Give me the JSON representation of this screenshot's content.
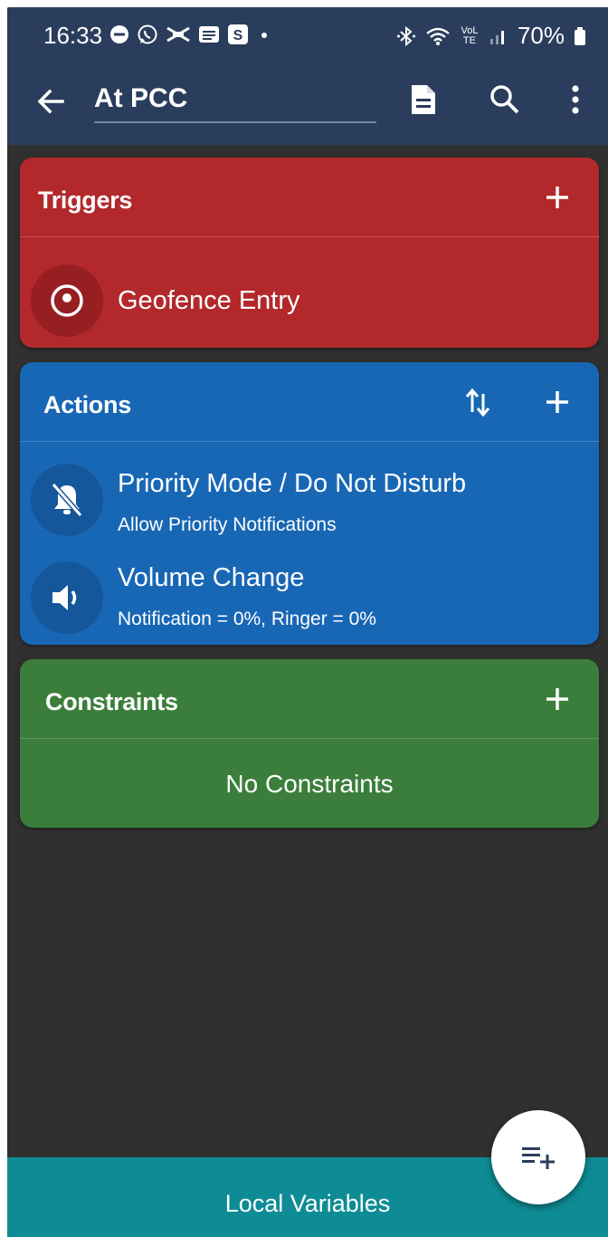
{
  "status_bar": {
    "time": "16:33",
    "battery": "70%",
    "network_label": "VoLTE"
  },
  "app_bar": {
    "title": "At PCC"
  },
  "triggers": {
    "title": "Triggers",
    "color": "#b3282b",
    "items": [
      {
        "title": "Geofence Entry",
        "icon": "location-pin-icon"
      }
    ]
  },
  "actions": {
    "title": "Actions",
    "color": "#1867b5",
    "items": [
      {
        "title": "Priority Mode / Do Not Disturb",
        "subtitle": "Allow Priority Notifications",
        "icon": "bell-off-icon"
      },
      {
        "title": "Volume Change",
        "subtitle": "Notification = 0%, Ringer = 0%",
        "icon": "speaker-icon"
      }
    ]
  },
  "constraints": {
    "title": "Constraints",
    "color": "#3b7e3c",
    "empty_text": "No Constraints"
  },
  "bottom_bar": {
    "label": "Local Variables",
    "color": "#0e8c95"
  },
  "fab": {
    "icon": "playlist-add-icon"
  }
}
